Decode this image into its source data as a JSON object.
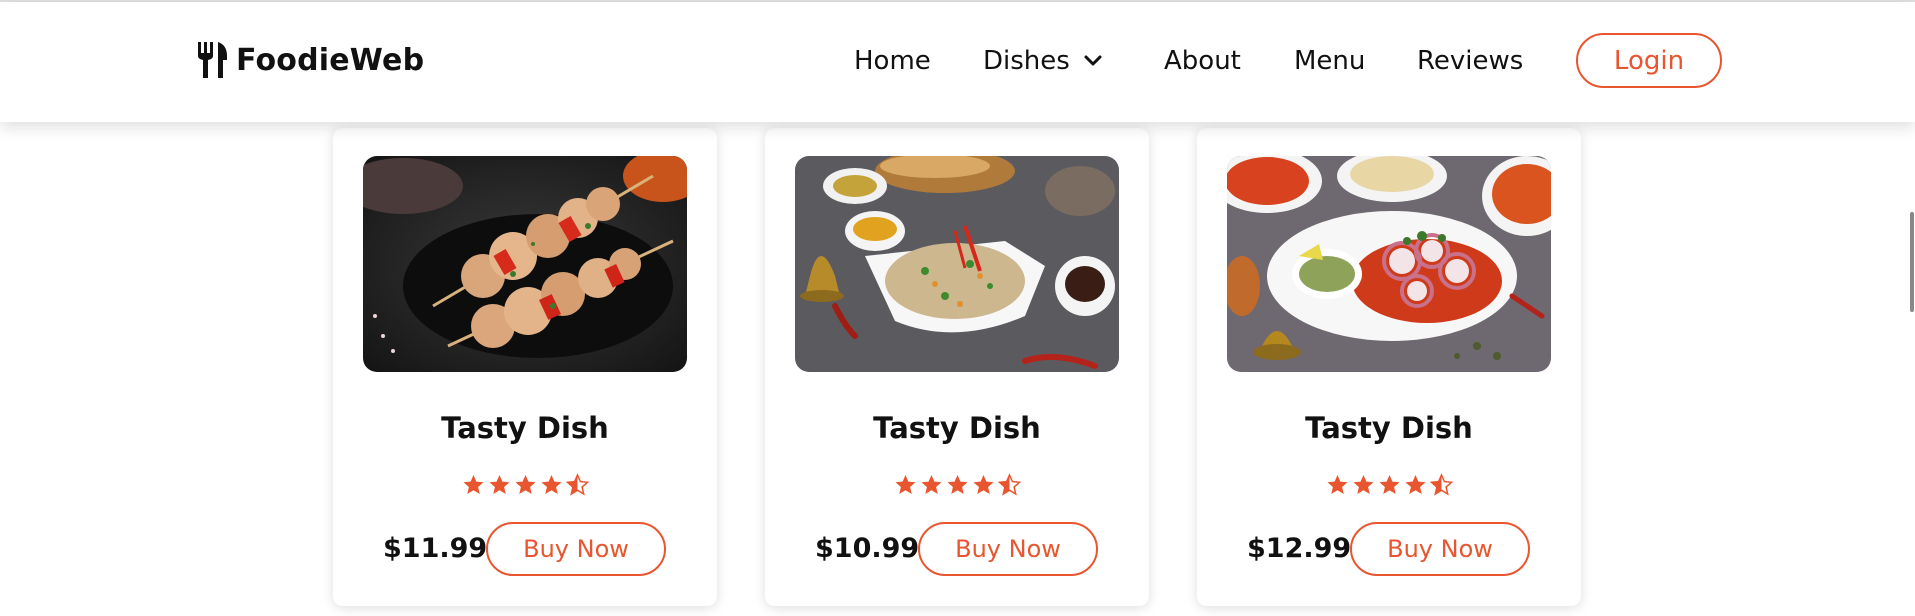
{
  "brand": {
    "name": "FoodieWeb",
    "icon": "fork-knife-icon"
  },
  "nav": {
    "home": "Home",
    "dishes": "Dishes",
    "about": "About",
    "menu": "Menu",
    "reviews": "Reviews",
    "login": "Login"
  },
  "colors": {
    "accent": "#e8552e",
    "text": "#111111",
    "background": "#ffffff"
  },
  "cards": [
    {
      "title": "Tasty Dish",
      "rating": 4.5,
      "price": "$11.99",
      "button": "Buy Now",
      "image": "chicken skewers on dark plate"
    },
    {
      "title": "Tasty Dish",
      "rating": 4.5,
      "price": "$10.99",
      "button": "Buy Now",
      "image": "fried rice in white bowl"
    },
    {
      "title": "Tasty Dish",
      "rating": 4.5,
      "price": "$12.99",
      "button": "Buy Now",
      "image": "tandoori platter with onions and chutney"
    }
  ]
}
